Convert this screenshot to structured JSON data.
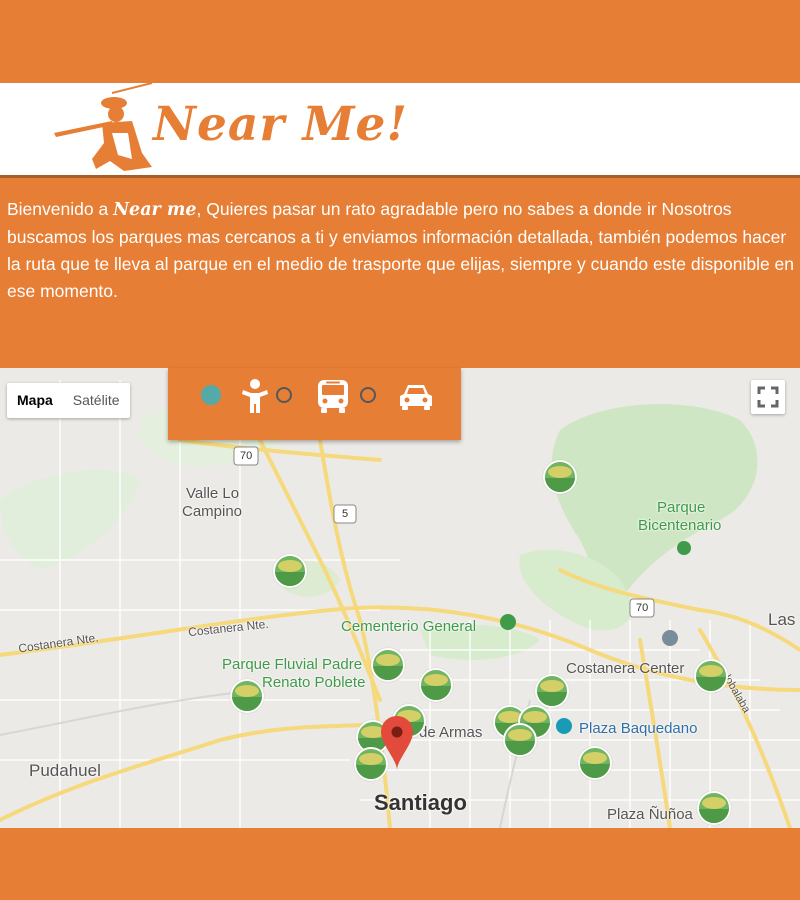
{
  "brand": {
    "logo_text": "Near Me!"
  },
  "intro": {
    "prefix": "Bienvenido a ",
    "brand_name": "Near me",
    "body": ", Quieres pasar un rato agradable pero no sabes a donde ir Nosotros buscamos los parques mas cercanos a ti y enviamos información detallada, también podemos hacer la ruta que te lleva al parque en el medio de trasporte que elijas, siempre y cuando este disponible en ese momento."
  },
  "map_controls": {
    "map_label": "Mapa",
    "satellite_label": "Satélite"
  },
  "transport_modes": [
    {
      "name": "walk",
      "icon": "person-icon",
      "selected": true
    },
    {
      "name": "bus",
      "icon": "bus-icon",
      "selected": false
    },
    {
      "name": "car",
      "icon": "car-icon",
      "selected": false
    }
  ],
  "map_labels": {
    "valle": "Valle Lo",
    "valle2": "Campino",
    "parque_bic": "Parque",
    "parque_bic2": "Bicentenario",
    "costanera_nte_left": "Costanera Nte.",
    "costanera_nte_mid": "Costanera Nte.",
    "cementerio": "Cementerio General",
    "fluvial": "Parque Fluvial Padre",
    "fluvial2": "Renato Poblete",
    "costanera_center": "Costanera Center",
    "armas": "de Armas",
    "baquedano": "Plaza Baquedano",
    "pudahuel": "Pudahuel",
    "santiago": "Santiago",
    "nunoa": "Plaza Ñuñoa",
    "las": "Las",
    "lobalaba": "lobalaba",
    "hw70a": "70",
    "hw70b": "70",
    "hw5": "5"
  },
  "colors": {
    "accent": "#e67e35",
    "selected_radio": "#55a9a6",
    "park_green": "#6fb562"
  }
}
